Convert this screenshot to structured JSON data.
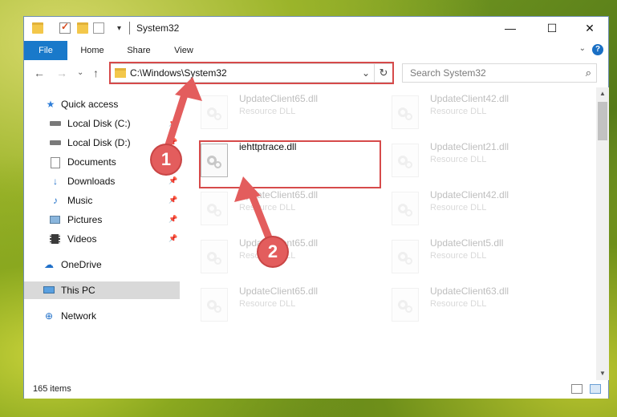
{
  "window": {
    "title": "System32",
    "controls": {
      "minimize": "—",
      "maximize": "☐",
      "close": "✕"
    }
  },
  "ribbon": {
    "tabs": [
      "File",
      "Home",
      "Share",
      "View"
    ],
    "help": "?"
  },
  "nav": {
    "back": "←",
    "forward": "→",
    "recent": "⌄",
    "up": "↑",
    "address": "C:\\Windows\\System32",
    "refresh": "↻",
    "search_placeholder": "Search System32"
  },
  "sidebar": {
    "items": [
      {
        "label": "Quick access",
        "icon": "star-icon",
        "pinned": false
      },
      {
        "label": "Local Disk (C:)",
        "icon": "drive-icon",
        "pinned": true
      },
      {
        "label": "Local Disk (D:)",
        "icon": "drive-icon",
        "pinned": true
      },
      {
        "label": "Documents",
        "icon": "documents-icon",
        "pinned": true
      },
      {
        "label": "Downloads",
        "icon": "download-icon",
        "pinned": true
      },
      {
        "label": "Music",
        "icon": "music-icon",
        "pinned": true
      },
      {
        "label": "Pictures",
        "icon": "pictures-icon",
        "pinned": true
      },
      {
        "label": "Videos",
        "icon": "videos-icon",
        "pinned": true
      },
      {
        "label": "OneDrive",
        "icon": "cloud-icon",
        "pinned": false
      },
      {
        "label": "This PC",
        "icon": "computer-icon",
        "pinned": false,
        "selected": true
      },
      {
        "label": "Network",
        "icon": "network-icon",
        "pinned": false
      }
    ]
  },
  "files": [
    {
      "name": "UpdateClient65.dll",
      "type": "Resource DLL",
      "faded": true
    },
    {
      "name": "UpdateClient42.dll",
      "type": "Resource DLL",
      "faded": true
    },
    {
      "name": "iehttptrace.dll",
      "type": "",
      "faded": false
    },
    {
      "name": "UpdateClient21.dll",
      "type": "Resource DLL",
      "faded": true
    },
    {
      "name": "UpdateClient65.dll",
      "type": "Resource DLL",
      "faded": true
    },
    {
      "name": "UpdateClient42.dll",
      "type": "Resource DLL",
      "faded": true
    },
    {
      "name": "UpdateClient65.dll",
      "type": "Resource DLL",
      "faded": true
    },
    {
      "name": "UpdateClient5.dll",
      "type": "Resource DLL",
      "faded": true
    },
    {
      "name": "UpdateClient65.dll",
      "type": "Resource DLL",
      "faded": true
    },
    {
      "name": "UpdateClient63.dll",
      "type": "Resource DLL",
      "faded": true
    }
  ],
  "status": {
    "item_count": "165 items"
  },
  "annotations": {
    "step1": "1",
    "step2": "2",
    "highlight_color": "#d64a4a"
  },
  "colors": {
    "accent": "#1979ca",
    "selection": "#d9d9d9"
  }
}
